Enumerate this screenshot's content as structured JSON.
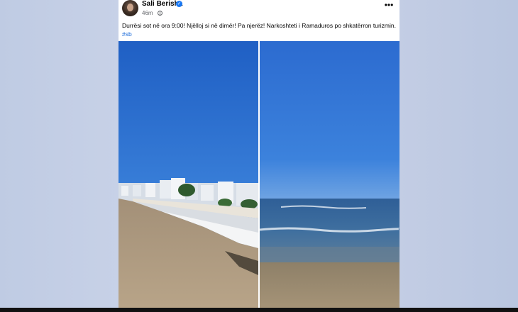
{
  "post": {
    "author": "Sali Berisha",
    "time": "46m",
    "verified_icon": "check-icon",
    "menu_glyph": "•••",
    "text": "Durrësi sot në ora 9:00! Njëlloj si në dimër! Pa njerëz! Narkoshteti i Ramaduros po shkatërron turizmin. ",
    "hashtag": "#sb"
  },
  "photos": [
    {
      "name": "beach-with-sunbeds-photo"
    },
    {
      "name": "sea-and-sky-photo"
    }
  ],
  "colors": {
    "background": "#c3cde4",
    "link": "#216fdb",
    "verified": "#1877f2"
  }
}
